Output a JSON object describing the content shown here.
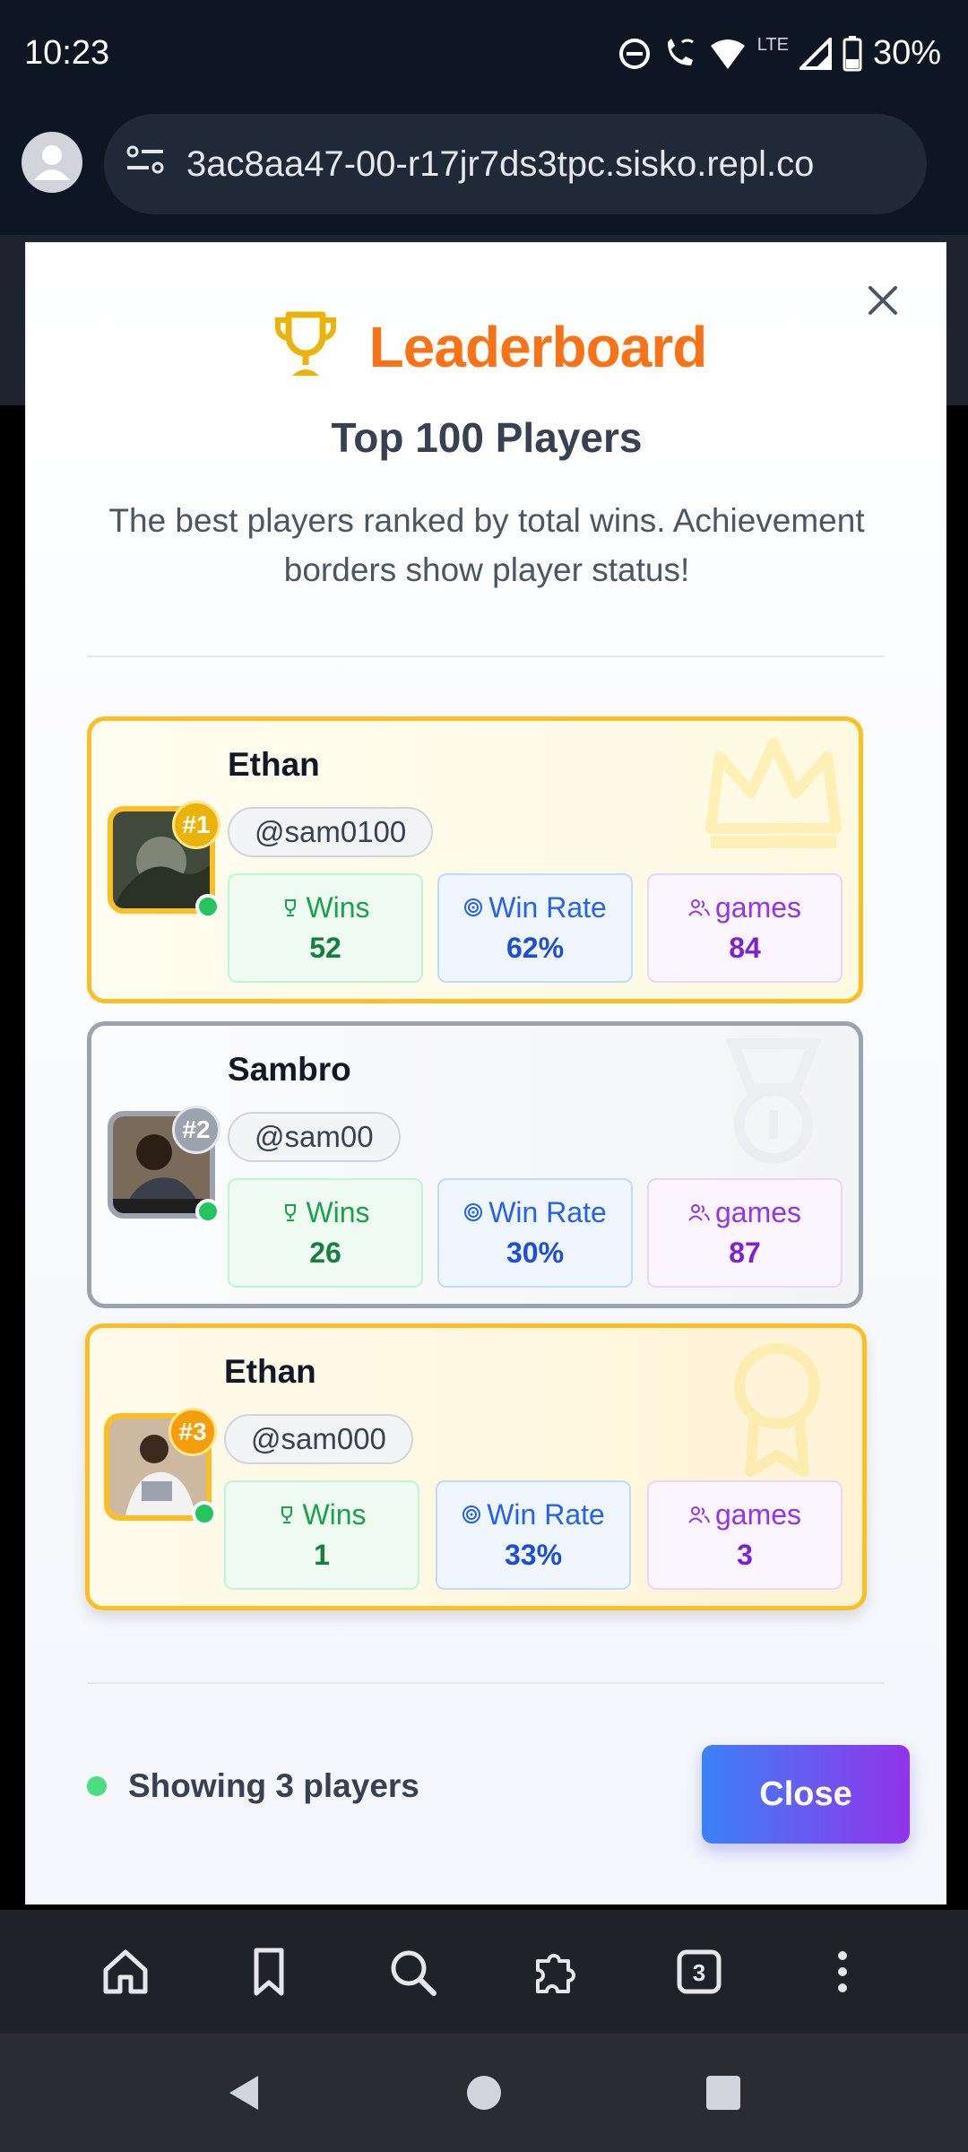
{
  "status_bar": {
    "time": "10:23",
    "network": "LTE",
    "battery": "30%"
  },
  "browser": {
    "url": "3ac8aa47-00-r17jr7ds3tpc.sisko.repl.co",
    "tab_count": "3"
  },
  "modal": {
    "title": "Leaderboard",
    "subtitle": "Top 100 Players",
    "description": "The best players ranked by total wins. Achievement borders show player status!",
    "players": [
      {
        "rank": "#1",
        "name": "Ethan",
        "handle": "@sam0100",
        "wins_label": "Wins",
        "wins": "52",
        "rate_label": "Win Rate",
        "rate": "62%",
        "games_label": "games",
        "games": "84"
      },
      {
        "rank": "#2",
        "name": "Sambro",
        "handle": "@sam00",
        "wins_label": "Wins",
        "wins": "26",
        "rate_label": "Win Rate",
        "rate": "30%",
        "games_label": "games",
        "games": "87"
      },
      {
        "rank": "#3",
        "name": "Ethan",
        "handle": "@sam000",
        "wins_label": "Wins",
        "wins": "1",
        "rate_label": "Win Rate",
        "rate": "33%",
        "games_label": "games",
        "games": "3"
      }
    ],
    "footer_status": "Showing 3 players",
    "close_label": "Close"
  },
  "colors": {
    "accent_orange": "#f97316",
    "gold": "#fbbf24",
    "silver": "#9ca3af",
    "online": "#22c55e"
  }
}
